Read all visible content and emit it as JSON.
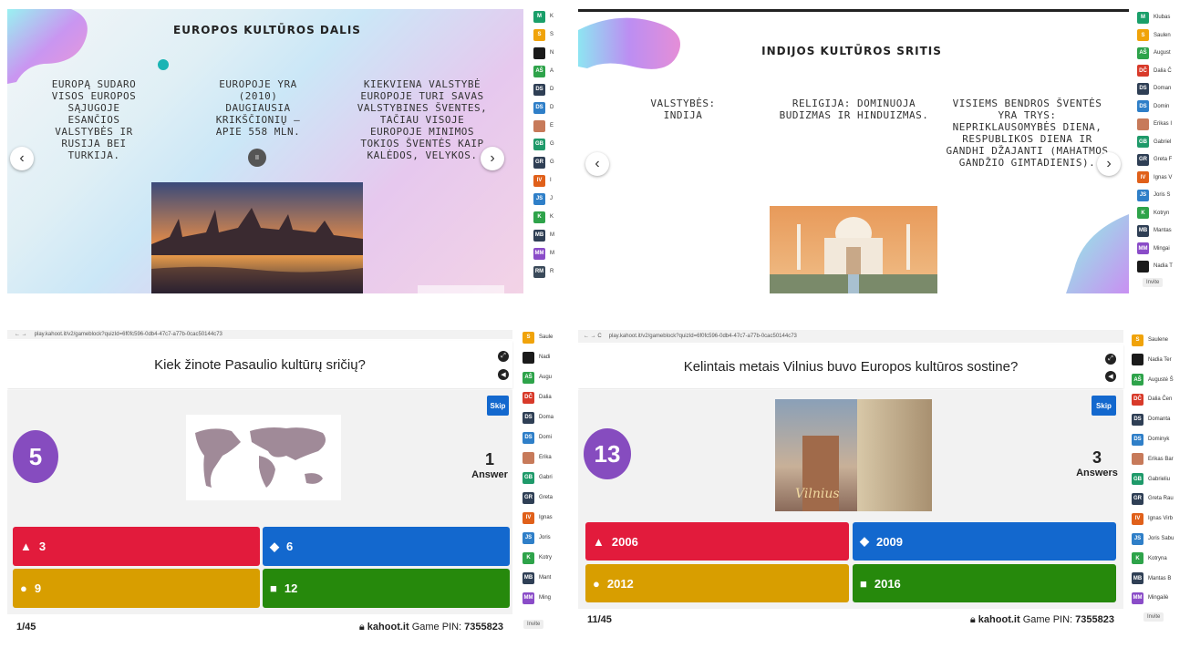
{
  "q1": {
    "title": "EUROPOS KULTŪROS DALIS",
    "col1": "EUROPĄ SUDARO VISOS EUROPOS SĄJUGOJE ESANČIOS VALSTYBĖS IR RUSIJA BEI TURKIJA.",
    "col2": "EUROPOJE YRA (2010) DAUGIAUSIA KRIKŠČIONIŲ – APIE 558 MLN.",
    "col3": "KIEKVIENA VALSTYBĖ EUROPOJE TURI SAVAS VALSTYBINES ŠVENTES, TAČIAU VISOJE EUROPOJE MINIMOS TOKIOS ŠVENTĖS KAIP KALĖDOS, VELYKOS.",
    "nav_prev": "‹",
    "nav_next": "›",
    "pause": "II",
    "participants": [
      {
        "initials": "M",
        "name": "K",
        "color": "#1a9f6a"
      },
      {
        "initials": "S",
        "name": "S",
        "color": "#f0a30a"
      },
      {
        "initials": "",
        "name": "N",
        "color": "#1a1a1a"
      },
      {
        "initials": "AŠ",
        "name": "A",
        "color": "#2ea34a"
      },
      {
        "initials": "DS",
        "name": "D",
        "color": "#2f3f55"
      },
      {
        "initials": "DS",
        "name": "D",
        "color": "#2f7fc8"
      },
      {
        "initials": "",
        "name": "E",
        "color": "#c77a5a"
      },
      {
        "initials": "GB",
        "name": "G",
        "color": "#1f9a6a"
      },
      {
        "initials": "GR",
        "name": "G",
        "color": "#2f3f55"
      },
      {
        "initials": "IV",
        "name": "I",
        "color": "#e0601a"
      },
      {
        "initials": "JS",
        "name": "J",
        "color": "#2f7fc8"
      },
      {
        "initials": "K",
        "name": "K",
        "color": "#2ea34a"
      },
      {
        "initials": "MB",
        "name": "M",
        "color": "#2f3f55"
      },
      {
        "initials": "MM",
        "name": "M",
        "color": "#8a4cc8"
      },
      {
        "initials": "RM",
        "name": "R",
        "color": "#3a4a5a"
      }
    ]
  },
  "q2": {
    "title": "INDIJOS KULTŪROS SRITIS",
    "col1": "VALSTYBĖS: INDIJA",
    "col2": "RELIGIJA: DOMINUOJA BUDIZMAS IR HINDUIZMAS.",
    "col3": "VISIEMS BENDROS ŠVENTĖS YRA TRYS: NEPRIKLAUSOMYBĖS DIENA, RESPUBLIKOS DIENA IR GANDHI DŽAJANTI (MAHATMOS GANDŽIO GIMTADIENIS).",
    "nav_prev": "‹",
    "nav_next": "›",
    "invite": "Invite",
    "participants": [
      {
        "initials": "M",
        "name": "Klubas",
        "color": "#1a9f6a"
      },
      {
        "initials": "S",
        "name": "Saulen",
        "color": "#f0a30a"
      },
      {
        "initials": "AŠ",
        "name": "August",
        "color": "#2ea34a"
      },
      {
        "initials": "DČ",
        "name": "Dalia Č",
        "color": "#d83a2a"
      },
      {
        "initials": "DS",
        "name": "Doman",
        "color": "#2f3f55"
      },
      {
        "initials": "DS",
        "name": "Domin",
        "color": "#2f7fc8"
      },
      {
        "initials": "",
        "name": "Erikas I",
        "color": "#c77a5a"
      },
      {
        "initials": "GB",
        "name": "Gabriel",
        "color": "#1f9a6a"
      },
      {
        "initials": "GR",
        "name": "Greta F",
        "color": "#2f3f55"
      },
      {
        "initials": "IV",
        "name": "Ignas V",
        "color": "#e0601a"
      },
      {
        "initials": "JS",
        "name": "Joris S",
        "color": "#2f7fc8"
      },
      {
        "initials": "K",
        "name": "Kotryn",
        "color": "#2ea34a"
      },
      {
        "initials": "MB",
        "name": "Mantas",
        "color": "#2f3f55"
      },
      {
        "initials": "MM",
        "name": "Mingai",
        "color": "#8a4cc8"
      },
      {
        "initials": "",
        "name": "Nadia T",
        "color": "#1a1a1a"
      }
    ]
  },
  "q3": {
    "url": "play.kahoot.it/v2/gameblock?quizId=6f0fc596-0db4-47c7-a77b-0cac50144c73",
    "question": "Kiek žinote Pasaulio kultūrų sričių?",
    "timer": "5",
    "skip": "Skip",
    "answers_count": "1",
    "answers_label": "Answer",
    "answers": [
      {
        "text": "3",
        "shape": "triangle",
        "color": "#e21b3c"
      },
      {
        "text": "6",
        "shape": "diamond",
        "color": "#1368ce"
      },
      {
        "text": "9",
        "shape": "circle",
        "color": "#d89e00"
      },
      {
        "text": "12",
        "shape": "square",
        "color": "#26890c"
      }
    ],
    "progress": "1/45",
    "brand": "kahoot.it",
    "pin_label": "Game PIN:",
    "pin": "7355823",
    "invite": "Invite",
    "participants": [
      {
        "initials": "S",
        "name": "Saule",
        "color": "#f0a30a"
      },
      {
        "initials": "",
        "name": "Nadi",
        "color": "#1a1a1a"
      },
      {
        "initials": "AŠ",
        "name": "Augu",
        "color": "#2ea34a"
      },
      {
        "initials": "DČ",
        "name": "Dalia",
        "color": "#d83a2a"
      },
      {
        "initials": "DS",
        "name": "Doma",
        "color": "#2f3f55"
      },
      {
        "initials": "DS",
        "name": "Domi",
        "color": "#2f7fc8"
      },
      {
        "initials": "",
        "name": "Erika",
        "color": "#c77a5a"
      },
      {
        "initials": "GB",
        "name": "Gabri",
        "color": "#1f9a6a"
      },
      {
        "initials": "GR",
        "name": "Greta",
        "color": "#2f3f55"
      },
      {
        "initials": "IV",
        "name": "Ignas",
        "color": "#e0601a"
      },
      {
        "initials": "JS",
        "name": "Joris",
        "color": "#2f7fc8"
      },
      {
        "initials": "K",
        "name": "Kotry",
        "color": "#2ea34a"
      },
      {
        "initials": "MB",
        "name": "Mant",
        "color": "#2f3f55"
      },
      {
        "initials": "MM",
        "name": "Ming",
        "color": "#8a4cc8"
      }
    ]
  },
  "q4": {
    "url": "play.kahoot.it/v2/gameblock?quizId=6f0fc596-0db4-47c7-a77b-0cac50144c73",
    "question": "Kelintais metais Vilnius buvo Europos kultūros sostine?",
    "timer": "13",
    "skip": "Skip",
    "answers_count": "3",
    "answers_label": "Answers",
    "image_caption": "Vilnius",
    "answers": [
      {
        "text": "2006",
        "shape": "triangle",
        "color": "#e21b3c"
      },
      {
        "text": "2009",
        "shape": "diamond",
        "color": "#1368ce"
      },
      {
        "text": "2012",
        "shape": "circle",
        "color": "#d89e00"
      },
      {
        "text": "2016",
        "shape": "square",
        "color": "#26890c"
      }
    ],
    "progress": "11/45",
    "brand": "kahoot.it",
    "pin_label": "Game PIN:",
    "pin": "7355823",
    "invite": "Invite",
    "participants": [
      {
        "initials": "S",
        "name": "Saulene",
        "color": "#f0a30a"
      },
      {
        "initials": "",
        "name": "Nadia Ter",
        "color": "#1a1a1a"
      },
      {
        "initials": "AŠ",
        "name": "Augustė Š",
        "color": "#2ea34a"
      },
      {
        "initials": "DČ",
        "name": "Dalia Čen",
        "color": "#d83a2a"
      },
      {
        "initials": "DS",
        "name": "Domanta",
        "color": "#2f3f55"
      },
      {
        "initials": "DS",
        "name": "Dominyk",
        "color": "#2f7fc8"
      },
      {
        "initials": "",
        "name": "Erikas Bar",
        "color": "#c77a5a"
      },
      {
        "initials": "GB",
        "name": "Gabrieliu",
        "color": "#1f9a6a"
      },
      {
        "initials": "GR",
        "name": "Greta Rau",
        "color": "#2f3f55"
      },
      {
        "initials": "IV",
        "name": "Ignas Virb",
        "color": "#e0601a"
      },
      {
        "initials": "JS",
        "name": "Joris Sabu",
        "color": "#2f7fc8"
      },
      {
        "initials": "K",
        "name": "Kotryna",
        "color": "#2ea34a"
      },
      {
        "initials": "MB",
        "name": "Mantas B",
        "color": "#2f3f55"
      },
      {
        "initials": "MM",
        "name": "Mingailė",
        "color": "#8a4cc8"
      }
    ]
  }
}
